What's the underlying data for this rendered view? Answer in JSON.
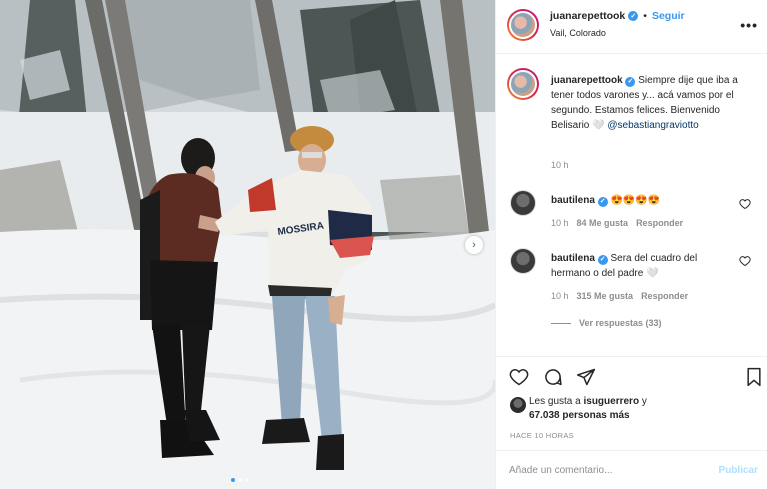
{
  "post": {
    "username": "juanarepettook",
    "follow_label": "Seguir",
    "separator": "•",
    "location": "Vail, Colorado",
    "more_label": "•••",
    "caption_text": "Siempre dije que iba a tener todos varones y... acá vamos por el segundo. Estamos felices. Bienvenido Belisario 🤍",
    "caption_mention": "@sebastiangraviotto",
    "caption_time": "10 h",
    "next_label": "›"
  },
  "comments": [
    {
      "username": "bautilena",
      "text": "😍😍😍😍",
      "time": "10 h",
      "likes": "84 Me gusta",
      "reply": "Responder"
    },
    {
      "username": "bautilena",
      "text": "Sera del cuadro del hermano o del padre 🤍",
      "time": "10 h",
      "likes": "315 Me gusta",
      "reply": "Responder"
    }
  ],
  "replies_label": "Ver respuestas (33)",
  "likes": {
    "prefix": "Les gusta a ",
    "user": "isuguerrero",
    "suffix": " y",
    "count": "67.038 personas más"
  },
  "time_ago": "HACE 10 HORAS",
  "add_comment": {
    "placeholder": "Añade un comentario...",
    "publish": "Publicar"
  },
  "icons": {
    "verified": "verified-badge-icon",
    "heart": "heart-icon",
    "comment": "comment-icon",
    "share": "send-icon",
    "save": "bookmark-icon"
  },
  "colors": {
    "accent": "#3897f0",
    "publish_disabled": "#b2dffc"
  }
}
